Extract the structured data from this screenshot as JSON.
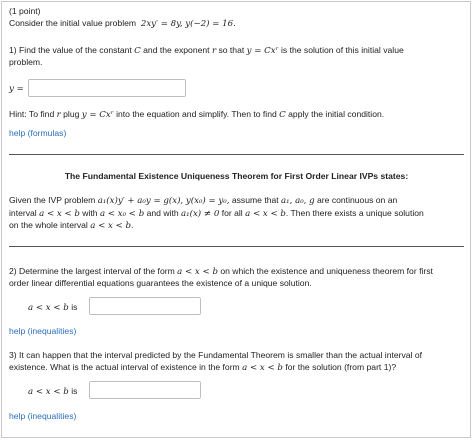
{
  "header": {
    "points": "(1 point)"
  },
  "problem": {
    "intro": "Consider the initial value problem",
    "equation": "2xy′ = 8y,   y(−2) = 16."
  },
  "part1": {
    "a": "1) Find the value of the constant",
    "C1": "C",
    "b": "and the exponent",
    "r1": "r",
    "c": "so that",
    "cond": "y = Cxʳ",
    "d": "is the solution of this initial value",
    "e": "problem.",
    "input_label": "y =",
    "input_value": "",
    "hint_a": "Hint: To find",
    "hint_r": "r",
    "hint_b": "plug",
    "hint_eq": "y = Cxʳ",
    "hint_c": "into the equation and simplify. Then to find",
    "hint_C": "C",
    "hint_d": "apply the initial condition.",
    "help": "help (formulas)"
  },
  "theorem": {
    "title": "The Fundamental Existence Uniqueness Theorem for First Order Linear IVPs states:",
    "l1_a": "Given the IVP problem",
    "l1_eq": "a₁(x)y′ + a₀y = g(x),   y(x₀) = y₀,",
    "l1_b": "assume that",
    "l1_vars": "a₁, a₀, g",
    "l1_c": "are continuous on an",
    "l2_a": "interval",
    "l2_i1": "a < x < b",
    "l2_b": "with",
    "l2_i2": "a < x₀ < b",
    "l2_c": "and with",
    "l2_i3": "a₁(x) ≠ 0",
    "l2_d": "for all",
    "l2_i4": "a < x < b",
    "l2_e": ". Then there exists a unique solution",
    "l3_a": "on the whole interval",
    "l3_i": "a < x < b",
    "l3_b": "."
  },
  "part2": {
    "l1_a": "2) Determine the largest interval of the form",
    "l1_i": "a < x < b",
    "l1_b": "on which the existence and uniqueness theorem for first",
    "l2": "order linear differential equations guarantees the existence of a unique solution.",
    "label_m": "a < x < b",
    "label_t": "is",
    "input_value": "",
    "help": "help (inequalities)"
  },
  "part3": {
    "l1": "3) It can happen that the interval predicted by the Fundamental Theorem is smaller than the actual interval of",
    "l2_a": "existence. What is the actual interval of existence in the form",
    "l2_i": "a < x < b",
    "l2_b": "for the solution (from part 1)?",
    "label_m": "a < x < b",
    "label_t": "is",
    "input_value": "",
    "help": "help (inequalities)"
  }
}
